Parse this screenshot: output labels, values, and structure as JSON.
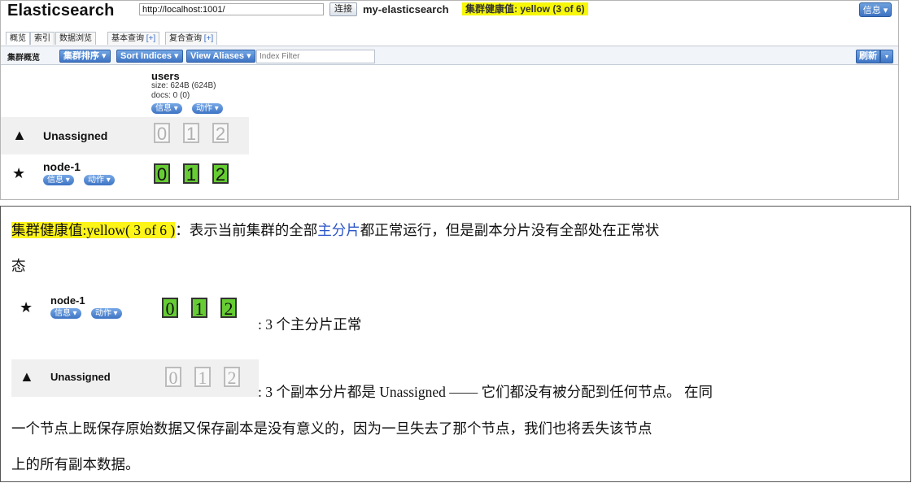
{
  "app": {
    "brand": "Elasticsearch",
    "url": "http://localhost:1001/",
    "connect_label": "连接",
    "cluster_name": "my-elasticsearch",
    "health_label": "集群健康值: yellow (3 of 6)",
    "health_color": "#f7f70a",
    "info_button": "信息 ▾"
  },
  "tabs": [
    {
      "label": "概览"
    },
    {
      "label": "索引"
    },
    {
      "label": "数据浏览"
    },
    {
      "label": "基本查询",
      "plus": "[+]"
    },
    {
      "label": "复合查询",
      "plus": "[+]"
    }
  ],
  "toolbar": {
    "title": "集群概览",
    "sort_button": "集群排序 ▾",
    "sort_indices_button": "Sort Indices ▾",
    "view_aliases_button": "View Aliases ▾",
    "filter_placeholder": "Index Filter",
    "refresh_button": "刷新",
    "refresh_caret": "▾"
  },
  "index": {
    "name": "users",
    "size": "size: 624B (624B)",
    "docs": "docs: 0 (0)",
    "info_pill": "信息 ▾",
    "action_pill": "动作 ▾"
  },
  "rows": {
    "unassigned": {
      "label": "Unassigned",
      "icon": "warning-icon",
      "shards": [
        "0",
        "1",
        "2"
      ]
    },
    "node": {
      "label": "node-1",
      "icon": "star-icon",
      "info_pill": "信息 ▾",
      "action_pill": "动作 ▾",
      "shards": [
        "0",
        "1",
        "2"
      ]
    }
  },
  "note": {
    "health_text": "集群健康值:yellow( 3 of 6 )",
    "line1_colon": "：",
    "line1_a": "表示当前集群的全部",
    "line1_link": "主分片",
    "line1_b": "都正常运行，但是副本分片没有全部处在正常状",
    "line2": "态",
    "primary_desc": ": 3 个主分片正常",
    "replica_desc": ": 3 个副本分片都是 Unassigned —— 它们都没有被分配到任何节点。 在同",
    "line5": "一个节点上既保存原始数据又保存副本是没有意义的，因为一旦失去了那个节点，我们也将丢失该节点",
    "line6": "上的所有副本数据。"
  }
}
